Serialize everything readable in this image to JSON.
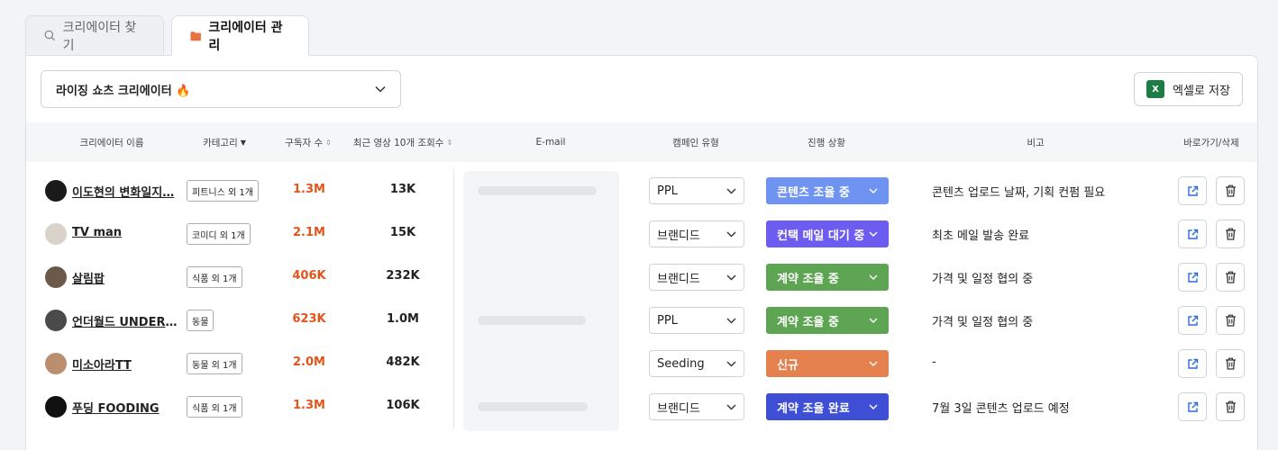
{
  "tabs": [
    {
      "label": "크리에이터 찾기",
      "icon": "search-icon"
    },
    {
      "label": "크리에이터 관리",
      "icon": "folder-icon"
    }
  ],
  "list_select": {
    "value": "라이징 쇼츠 크리에이터 🔥"
  },
  "excel_button": {
    "label": "엑셀로 저장",
    "icon_text": "X"
  },
  "table": {
    "headers": {
      "name": "크리에이터 이름",
      "category": "카테고리",
      "subscribers": "구독자 수",
      "views": "최근 영상 10개 조회수",
      "email": "E-mail",
      "campaign": "캠페인 유형",
      "status": "진행 상황",
      "note": "비고",
      "actions": "바로가기/삭제"
    },
    "rows": [
      {
        "name": "이도현의 변화일지…",
        "category": "피트니스 외 1개",
        "subscribers": "1.3M",
        "views": "13K",
        "campaign": "PPL",
        "status": "콘텐츠 조율 중",
        "status_color": "#6f93f1",
        "note": "콘텐츠 업로드 날짜, 기획 컨펌 필요"
      },
      {
        "name": "TV man",
        "category": "코미디 외 1개",
        "subscribers": "2.1M",
        "views": "15K",
        "campaign": "브랜디드",
        "status": "컨택 메일 대기 중",
        "status_color": "#6c5cf0",
        "note": "최초 메일 발송 완료"
      },
      {
        "name": "살림팝",
        "category": "식품 외 1개",
        "subscribers": "406K",
        "views": "232K",
        "campaign": "브랜디드",
        "status": "계약 조율 중",
        "status_color": "#5ea553",
        "note": "가격 및 일정 협의 중"
      },
      {
        "name": "언더월드 UNDER …",
        "category": "동물",
        "subscribers": "623K",
        "views": "1.0M",
        "campaign": "PPL",
        "status": "계약 조율 중",
        "status_color": "#5ea553",
        "note": "가격 및 일정 협의 중"
      },
      {
        "name": "미소아라TT",
        "category": "동물 외 1개",
        "subscribers": "2.0M",
        "views": "482K",
        "campaign": "Seeding",
        "status": "신규",
        "status_color": "#e5804f",
        "note": "-"
      },
      {
        "name": "푸딩 FOODING",
        "category": "식품 외 1개",
        "subscribers": "1.3M",
        "views": "106K",
        "campaign": "브랜디드",
        "status": "계약 조율 완료",
        "status_color": "#3e4fd6",
        "note": "7월 3일 콘텐츠 업로드 예정"
      }
    ]
  },
  "colors": {
    "subscribers_text": "#e3541b",
    "tab_folder": "#e8713f",
    "excel_green": "#1e7d45"
  }
}
